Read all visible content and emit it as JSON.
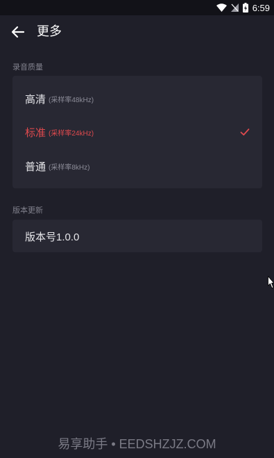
{
  "status_bar": {
    "time": "6:59",
    "icons": [
      "wifi-icon",
      "no-signal-icon",
      "battery-charging-icon"
    ]
  },
  "header": {
    "title": "更多",
    "back_icon": "arrow-left-icon"
  },
  "recording_quality": {
    "section_label": "录音质量",
    "options": [
      {
        "name": "高清",
        "rate": "(采样率48kHz)",
        "selected": false
      },
      {
        "name": "标准",
        "rate": "(采样率24kHz)",
        "selected": true
      },
      {
        "name": "普通",
        "rate": "(采样率8kHz)",
        "selected": false
      }
    ],
    "check_icon": "checkmark-icon"
  },
  "version_update": {
    "section_label": "版本更新",
    "version_text": "版本号1.0.0"
  },
  "watermark": "易享助手 • EEDSHZJZ.COM",
  "colors": {
    "background": "#1f1f29",
    "card": "#282833",
    "accent": "#e04a4e",
    "status_bar": "#121218"
  }
}
